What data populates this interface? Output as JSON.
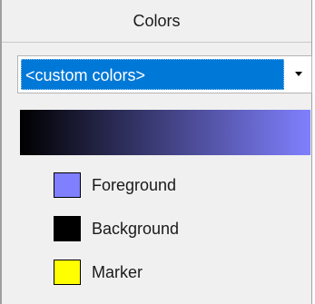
{
  "panel": {
    "title": "Colors"
  },
  "scheme_select": {
    "value": "<custom colors>"
  },
  "gradient": {
    "start_color": "#000000",
    "end_color": "#8080ff"
  },
  "legend": [
    {
      "label": "Foreground",
      "color": "#8080ff"
    },
    {
      "label": "Background",
      "color": "#000000"
    },
    {
      "label": "Marker",
      "color": "#ffff00"
    }
  ]
}
